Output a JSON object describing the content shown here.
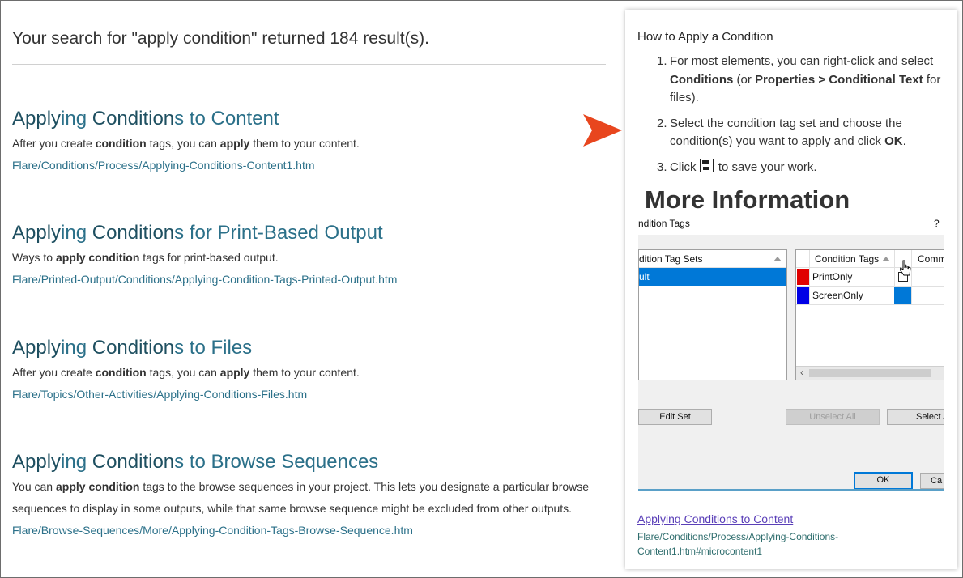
{
  "search": {
    "summary": "Your search for \"apply condition\" returned 184 result(s)."
  },
  "results": [
    {
      "t1": "Apply",
      "t2": "ing ",
      "t3": "Condition",
      "t4": "s to Content",
      "desc": [
        "After you create ",
        "condition",
        " tags, you can ",
        "apply",
        " them to your content."
      ],
      "url": "Flare/Conditions/Process/Applying-Conditions-Content1.htm"
    },
    {
      "t1": "Apply",
      "t2": "ing ",
      "t3": "Condition",
      "t4": "s for Print-Based Output",
      "desc": [
        "Ways to ",
        "apply condition",
        " tags for print-based output."
      ],
      "url": "Flare/Printed-Output/Conditions/Applying-Condition-Tags-Printed-Output.htm"
    },
    {
      "t1": "Apply",
      "t2": "ing ",
      "t3": "Condition",
      "t4": "s to Files",
      "desc": [
        "After you create ",
        "condition",
        " tags, you can ",
        "apply",
        " them to your content."
      ],
      "url": "Flare/Topics/Other-Activities/Applying-Conditions-Files.htm"
    },
    {
      "t1": "Apply",
      "t2": "ing ",
      "t3": "Condition",
      "t4": "s to Browse Sequences",
      "desc": [
        "You can ",
        "apply condition",
        " tags to the browse sequences in your project. This lets you designate a particular browse sequences to display in some outputs, while that same browse sequence might be excluded from other outputs."
      ],
      "url": "Flare/Browse-Sequences/More/Applying-Condition-Tags-Browse-Sequence.htm"
    }
  ],
  "preview": {
    "heading": "How to Apply a Condition",
    "step1": {
      "num": "1.",
      "a": "For most elements, you can right-click and select ",
      "b": "Conditions",
      "c": " (or ",
      "d": "Properties > Conditional Text",
      "e": " for files)."
    },
    "step2": {
      "num": "2.",
      "a": "Select the condition tag set and choose the condition(s) you want to apply and click ",
      "b": "OK",
      "c": "."
    },
    "step3": {
      "num": "3.",
      "a": "Click ",
      "b": " to save your work."
    },
    "more_info": "More Information",
    "dialog": {
      "title": "ndition Tags",
      "help": "?",
      "sets_header": "dition Tag Sets",
      "selected_set": "ult",
      "tags_header": "Condition Tags",
      "comments_header": "Comme",
      "tags": [
        {
          "name": "PrintOnly",
          "color": "#e00000"
        },
        {
          "name": "ScreenOnly",
          "color": "#0000e6"
        }
      ],
      "scroll_left": "‹",
      "edit_set": "Edit Set",
      "unselect_all": "Unselect All",
      "select_all": "Select A",
      "ok": "OK",
      "cancel": "Ca"
    },
    "link": "Applying Conditions to Content",
    "path": "Flare/Conditions/Process/Applying-Conditions-Content1.htm#microcontent1"
  },
  "colors": {
    "title": "#2b7089",
    "highlight": "#1e4f60",
    "arrow": "#e8461e",
    "selection": "#0078d7"
  },
  "icons": [
    "pointer-arrow-icon",
    "save-icon",
    "help-icon",
    "sort-up-icon",
    "mouse-cursor-icon"
  ]
}
